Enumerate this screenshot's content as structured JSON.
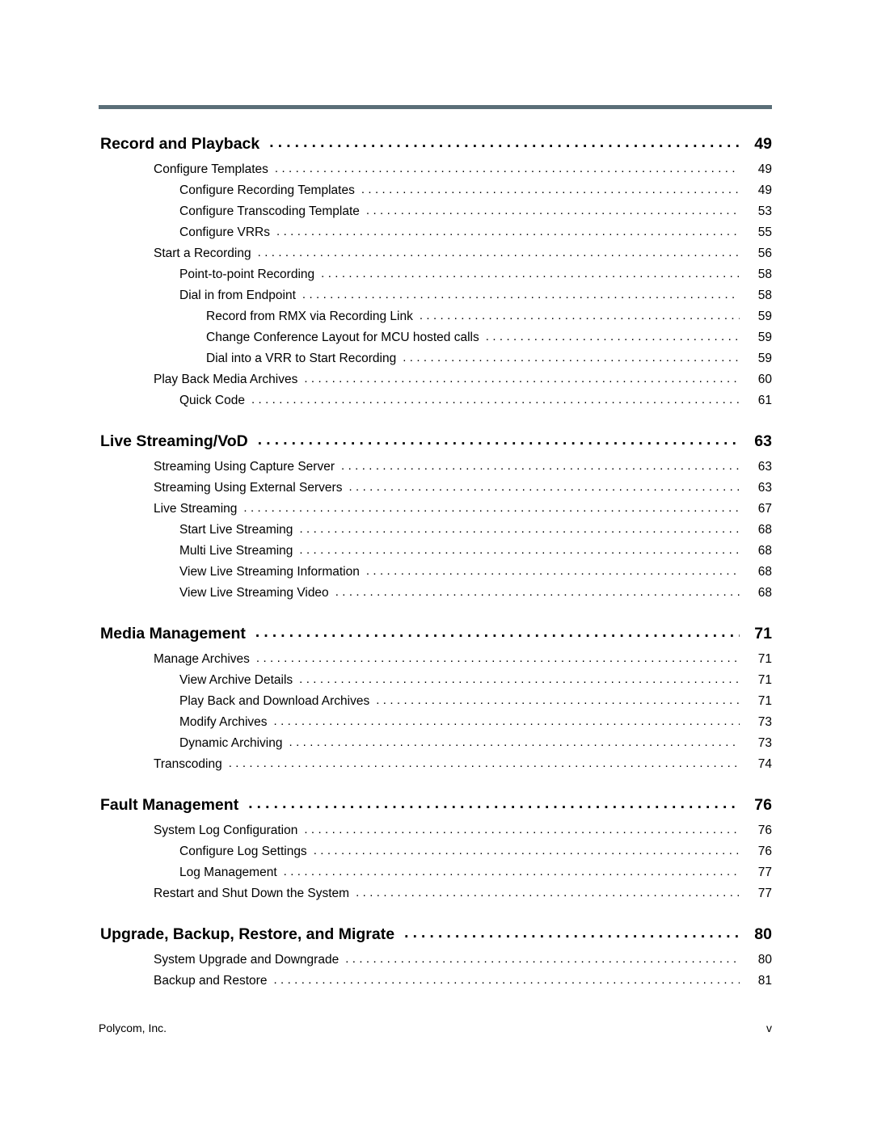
{
  "document": {
    "page_label": "v",
    "footer_company": "Polycom, Inc.",
    "rule_color": "#5a6e78"
  },
  "toc": {
    "entries": [
      {
        "level": 0,
        "label": "Record and Playback",
        "page": "49",
        "section_start": false
      },
      {
        "level": 1,
        "label": "Configure Templates",
        "page": "49",
        "section_start": false
      },
      {
        "level": 2,
        "label": "Configure Recording Templates",
        "page": "49",
        "section_start": false
      },
      {
        "level": 2,
        "label": "Configure Transcoding Template",
        "page": "53",
        "section_start": false
      },
      {
        "level": 2,
        "label": "Configure VRRs",
        "page": "55",
        "section_start": false
      },
      {
        "level": 1,
        "label": "Start a Recording",
        "page": "56",
        "section_start": false
      },
      {
        "level": 2,
        "label": "Point-to-point Recording",
        "page": "58",
        "section_start": false
      },
      {
        "level": 2,
        "label": "Dial in from Endpoint",
        "page": "58",
        "section_start": false
      },
      {
        "level": 3,
        "label": "Record from RMX via Recording Link",
        "page": "59",
        "section_start": false
      },
      {
        "level": 3,
        "label": "Change Conference Layout for MCU hosted calls",
        "page": "59",
        "section_start": false
      },
      {
        "level": 3,
        "label": "Dial into a VRR to Start Recording",
        "page": "59",
        "section_start": false
      },
      {
        "level": 1,
        "label": "Play Back Media Archives",
        "page": "60",
        "section_start": false
      },
      {
        "level": 2,
        "label": "Quick Code",
        "page": "61",
        "section_start": false
      },
      {
        "level": 0,
        "label": "Live Streaming/VoD",
        "page": "63",
        "section_start": true
      },
      {
        "level": 1,
        "label": "Streaming Using Capture Server",
        "page": "63",
        "section_start": false
      },
      {
        "level": 1,
        "label": "Streaming Using External Servers",
        "page": "63",
        "section_start": false
      },
      {
        "level": 1,
        "label": "Live Streaming",
        "page": "67",
        "section_start": false
      },
      {
        "level": 2,
        "label": "Start Live Streaming",
        "page": "68",
        "section_start": false
      },
      {
        "level": 2,
        "label": "Multi Live Streaming",
        "page": "68",
        "section_start": false
      },
      {
        "level": 2,
        "label": "View Live Streaming Information",
        "page": "68",
        "section_start": false
      },
      {
        "level": 2,
        "label": "View Live Streaming Video",
        "page": "68",
        "section_start": false
      },
      {
        "level": 0,
        "label": "Media Management",
        "page": "71",
        "section_start": true
      },
      {
        "level": 1,
        "label": "Manage Archives",
        "page": "71",
        "section_start": false
      },
      {
        "level": 2,
        "label": "View Archive Details",
        "page": "71",
        "section_start": false
      },
      {
        "level": 2,
        "label": "Play Back and Download Archives",
        "page": "71",
        "section_start": false
      },
      {
        "level": 2,
        "label": "Modify Archives",
        "page": "73",
        "section_start": false
      },
      {
        "level": 2,
        "label": "Dynamic Archiving",
        "page": "73",
        "section_start": false
      },
      {
        "level": 1,
        "label": "Transcoding",
        "page": "74",
        "section_start": false
      },
      {
        "level": 0,
        "label": "Fault Management",
        "page": "76",
        "section_start": true
      },
      {
        "level": 1,
        "label": "System Log Configuration",
        "page": "76",
        "section_start": false
      },
      {
        "level": 2,
        "label": "Configure Log Settings",
        "page": "76",
        "section_start": false
      },
      {
        "level": 2,
        "label": "Log Management",
        "page": "77",
        "section_start": false
      },
      {
        "level": 1,
        "label": "Restart and Shut Down the System",
        "page": "77",
        "section_start": false
      },
      {
        "level": 0,
        "label": "Upgrade, Backup, Restore, and Migrate",
        "page": "80",
        "section_start": true
      },
      {
        "level": 1,
        "label": "System Upgrade and Downgrade",
        "page": "80",
        "section_start": false
      },
      {
        "level": 1,
        "label": "Backup and Restore",
        "page": "81",
        "section_start": false
      }
    ]
  }
}
